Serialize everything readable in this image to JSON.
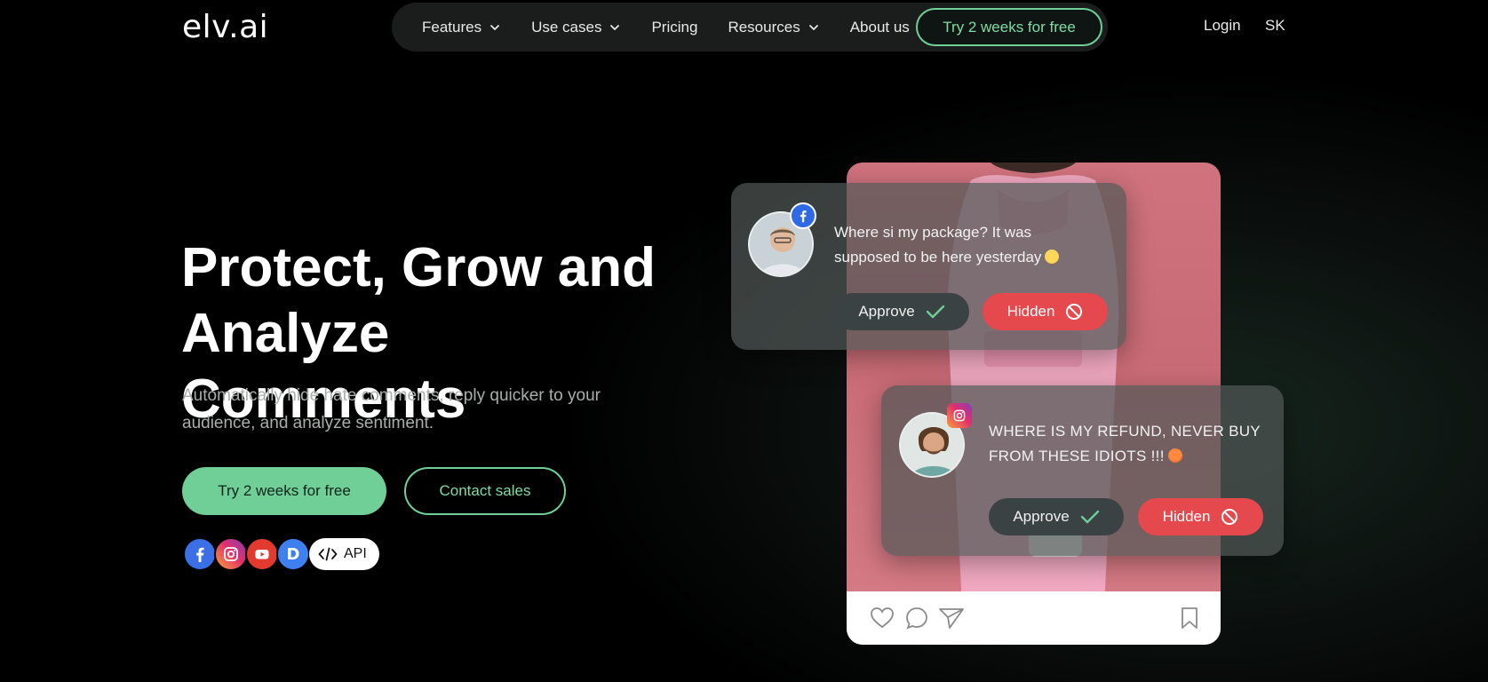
{
  "header": {
    "logo": "elv.ai",
    "nav": [
      {
        "label": "Features",
        "has_dropdown": true
      },
      {
        "label": "Use cases",
        "has_dropdown": true
      },
      {
        "label": "Pricing",
        "has_dropdown": false
      },
      {
        "label": "Resources",
        "has_dropdown": true
      },
      {
        "label": "About us",
        "has_dropdown": false
      }
    ],
    "cta": "Try 2 weeks for free",
    "login": "Login",
    "language": "SK"
  },
  "hero": {
    "title_line1": "Protect, Grow and",
    "title_line2": "Analyze Comments",
    "subtitle": "Automatically hide hate comments, reply quicker to your audience, and analyze sentiment.",
    "primary_cta": "Try 2 weeks for free",
    "secondary_cta": "Contact sales",
    "platforms": [
      "facebook-icon",
      "instagram-icon",
      "youtube-icon",
      "d-icon"
    ],
    "api_label": "API"
  },
  "comments": [
    {
      "platform": "facebook-icon",
      "text": "Where si my package? It was supposed to be here yesterday",
      "approve_label": "Approve",
      "hidden_label": "Hidden"
    },
    {
      "platform": "instagram-icon",
      "text": "WHERE IS MY REFUND, NEVER BUY FROM THESE IDIOTS !!!",
      "approve_label": "Approve",
      "hidden_label": "Hidden"
    }
  ],
  "colors": {
    "accent": "#6fcf97",
    "danger": "#e5484d",
    "background": "#000000",
    "phone_bg": "#d0737e"
  }
}
